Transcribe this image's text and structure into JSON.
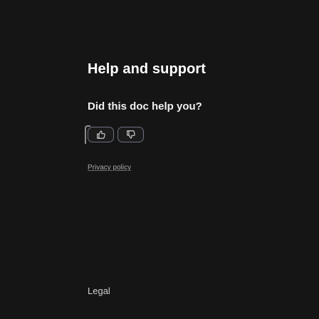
{
  "help": {
    "title": "Help and support",
    "question": "Did this doc help you?",
    "privacy_link": "Privacy policy"
  },
  "feedback": {
    "buttons": [
      {
        "icon": "thumbs-up-icon"
      },
      {
        "icon": "thumbs-down-icon"
      }
    ]
  },
  "footer": {
    "legal_label": "Legal"
  },
  "colors": {
    "background": "#151515",
    "text": "#ffffff",
    "button_border": "#6b7280",
    "link": "#a9a9a9"
  }
}
